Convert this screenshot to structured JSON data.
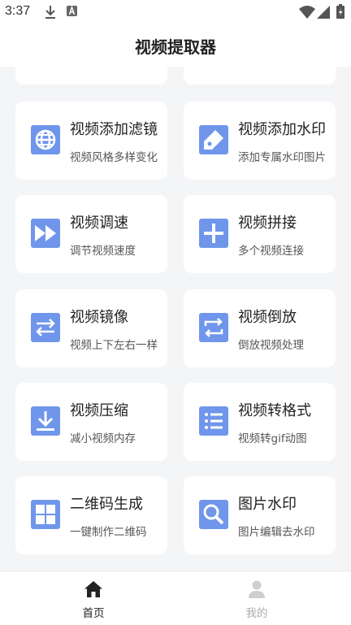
{
  "statusbar": {
    "time": "3:37"
  },
  "appbar": {
    "title": "视频提取器"
  },
  "colors": {
    "accent": "#6f96ea",
    "card_bg": "#ffffff",
    "page_bg": "#f4f5f7"
  },
  "cards": [
    {
      "title": "视频添加滤镜",
      "subtitle": "视频风格多样变化",
      "icon": "globe-icon"
    },
    {
      "title": "视频添加水印",
      "subtitle": "添加专属水印图片",
      "icon": "tag-icon"
    },
    {
      "title": "视频调速",
      "subtitle": "调节视频速度",
      "icon": "fast-forward-icon"
    },
    {
      "title": "视频拼接",
      "subtitle": "多个视频连接",
      "icon": "plus-icon"
    },
    {
      "title": "视频镜像",
      "subtitle": "视频上下左右一样",
      "icon": "swap-arrows-icon"
    },
    {
      "title": "视频倒放",
      "subtitle": "倒放视频处理",
      "icon": "repeat-icon"
    },
    {
      "title": "视频压缩",
      "subtitle": "减小视频内存",
      "icon": "download-icon"
    },
    {
      "title": "视频转格式",
      "subtitle": "视频转gif动图",
      "icon": "list-icon"
    },
    {
      "title": "二维码生成",
      "subtitle": "一键制作二维码",
      "icon": "grid-icon"
    },
    {
      "title": "图片水印",
      "subtitle": "图片编辑去水印",
      "icon": "search-icon"
    }
  ],
  "bottom_nav": [
    {
      "label": "首页",
      "icon": "home-icon",
      "active": true
    },
    {
      "label": "我的",
      "icon": "user-icon",
      "active": false
    }
  ]
}
